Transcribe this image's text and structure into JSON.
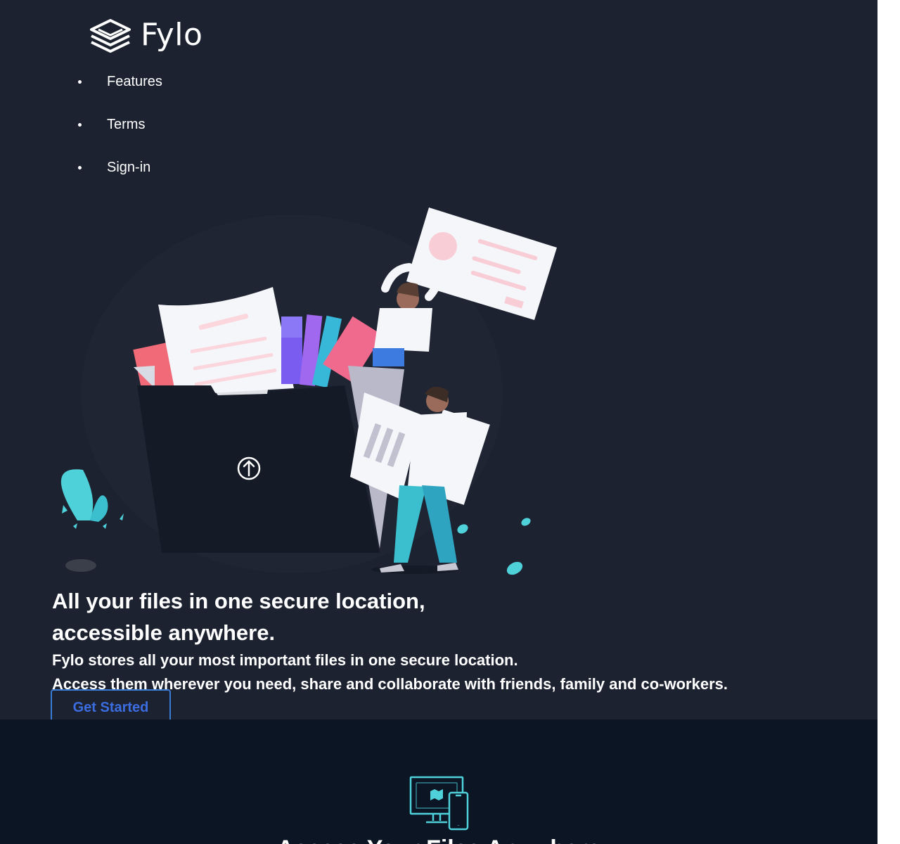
{
  "brand": {
    "name": "Fylo"
  },
  "nav": {
    "items": [
      {
        "label": "Features"
      },
      {
        "label": "Terms"
      },
      {
        "label": "Sign-in"
      }
    ]
  },
  "hero": {
    "title_line1": "All your files in one secure location,",
    "title_line2": "accessible anywhere.",
    "text_line1": "Fylo stores all your most important files in one secure location.",
    "text_line2": "Access them wherever you need, share and collaborate with friends, family and co-workers.",
    "cta_label": "Get Started"
  },
  "features": {
    "section_title": "Access Your Files Anywhere"
  },
  "colors": {
    "page_background": "#1c2230",
    "features_background": "#0c1524",
    "cta_border": "#3a7bd5",
    "cta_text": "#3b6ce0",
    "accent_cyan": "#4fd1d9"
  },
  "icons": {
    "logo": "stacked-layers-icon",
    "hero_upload": "upload-arrow-icon",
    "features_access": "devices-icon"
  }
}
